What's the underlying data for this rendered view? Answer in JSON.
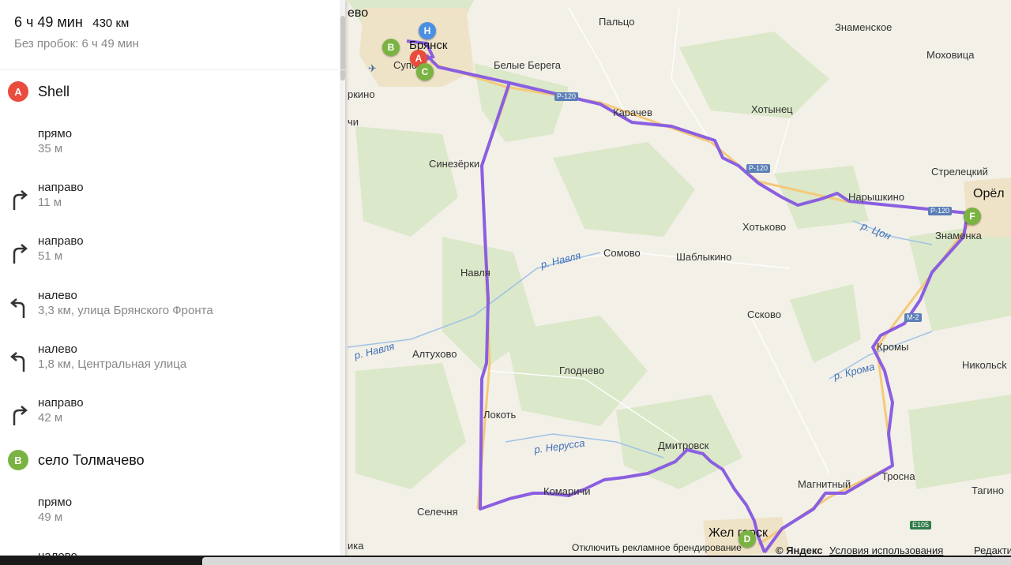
{
  "route": {
    "duration": "6 ч 49 мин",
    "distance": "430 км",
    "no_traffic": "Без пробок: 6 ч 49 мин"
  },
  "colors": {
    "route": "#8a5fe0",
    "marker_a": "#e94b3c",
    "marker_green": "#7bb342",
    "marker_blue": "#4a90e2"
  },
  "waypoints": [
    {
      "letter": "A",
      "label": "Shell"
    },
    {
      "letter": "B",
      "label": "село Толмачево"
    }
  ],
  "steps": [
    {
      "icon": "straight-icon",
      "title": "прямо",
      "detail": "35 м"
    },
    {
      "icon": "turn-right-icon",
      "title": "направо",
      "detail": "11 м"
    },
    {
      "icon": "turn-right-icon",
      "title": "направо",
      "detail": "51 м"
    },
    {
      "icon": "turn-left-icon",
      "title": "налево",
      "detail": "3,3 км, улица Брянского Фронта"
    },
    {
      "icon": "turn-left-icon",
      "title": "налево",
      "detail": "1,8 км, Центральная улица"
    },
    {
      "icon": "turn-right-icon",
      "title": "направо",
      "detail": "42 м"
    },
    {
      "icon": "straight-icon",
      "title": "прямо",
      "detail": "49 м"
    },
    {
      "icon": "turn-left-icon",
      "title": "налево",
      "detail": ""
    }
  ],
  "map": {
    "places": {
      "bryansk": "Брянск",
      "palco": "Пальцо",
      "znamenskoe": "Знаменское",
      "mohovica": "Моховица",
      "belye_berega": "Белые Берега",
      "karachev": "Карачев",
      "hotynec": "Хотынец",
      "sinezerki": "Синезёрки",
      "streleckiy": "Стрелецкий",
      "orel": "Орёл",
      "naryshkino": "Нарышкино",
      "znamenka": "Знаменка",
      "hotkovo": "Хотьково",
      "navlya": "Навля",
      "somovo": "Сомово",
      "shablykino": "Шаблыкино",
      "sskovo": "Ссково",
      "kromy": "Кромы",
      "altuhovo": "Алтухово",
      "glodnevo": "Глоднево",
      "nikolskoe": "Никольсk",
      "lokot": "Локоть",
      "dmitrovsk": "Дмитровск",
      "magnitny": "Магнитный",
      "trosna": "Тросна",
      "tagino": "Тагино",
      "komarichi": "Комаричи",
      "selechnya": "Селечня",
      "zheleznogorsk": "Жел  горск",
      "supo": "Супо",
      "evo": "ево",
      "rkino": "ркино",
      "chi": "чи",
      "ika": "ика"
    },
    "rivers": {
      "navlya1": "р. Навля",
      "navlya2": "р. Навля",
      "con": "р. Цон",
      "kroma": "р. Крома",
      "nerussa": "р. Нерусса"
    },
    "roads": {
      "r120a": "Р-120",
      "r120b": "Р-120",
      "r120c": "Р-120",
      "m2": "М-2",
      "e105": "E105"
    },
    "markers": {
      "h": "H",
      "a": "A",
      "b": "B",
      "c": "C",
      "d": "D",
      "f": "F"
    },
    "footer": {
      "disable_ads": "Отключить рекламное брендирование",
      "yandex": "© Яндекс",
      "terms": "Условия использования",
      "edit": "Редакти"
    }
  }
}
